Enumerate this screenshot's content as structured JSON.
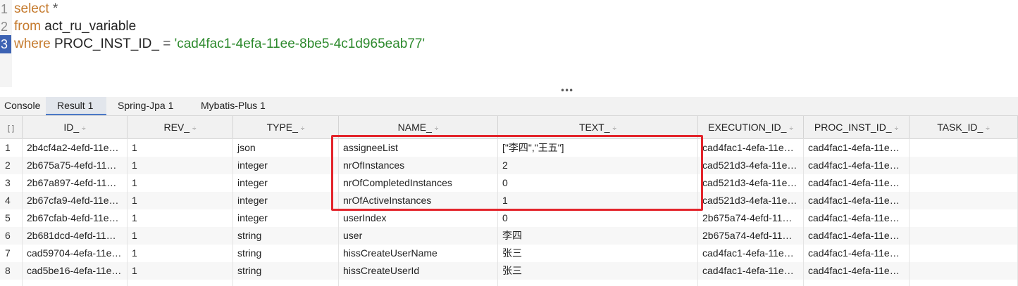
{
  "editor": {
    "lines": [
      {
        "num": "1",
        "parts": [
          {
            "t": "select",
            "k": "kw"
          },
          {
            "t": " *",
            "k": "sym"
          }
        ]
      },
      {
        "num": "2",
        "parts": [
          {
            "t": "from",
            "k": "kw"
          },
          {
            "t": " act_ru_variable",
            "k": ""
          }
        ]
      },
      {
        "num": "3",
        "parts": [
          {
            "t": "where",
            "k": "kw"
          },
          {
            "t": " PROC_INST_ID_ ",
            "k": ""
          },
          {
            "t": "=",
            "k": "sym"
          },
          {
            "t": " 'cad4fac1-4efa-11ee-8be5-4c1d965eab77'",
            "k": "str"
          }
        ]
      }
    ],
    "active_line": "3"
  },
  "splitter_glyph": "•••",
  "tabs": [
    {
      "label": "Console",
      "active": false
    },
    {
      "label": "Result 1",
      "active": true
    },
    {
      "label": "Spring-Jpa 1",
      "active": false
    },
    {
      "label": "Mybatis-Plus 1",
      "active": false
    }
  ],
  "grid": {
    "corner_glyph": "[ ]",
    "sort_glyph": "÷",
    "columns": [
      "ID_",
      "REV_",
      "TYPE_",
      "NAME_",
      "TEXT_",
      "EXECUTION_ID_",
      "PROC_INST_ID_",
      "TASK_ID_"
    ],
    "rows": [
      [
        "1",
        "2b4cf4a2-4efd-11e…",
        "1",
        "json",
        "assigneeList",
        "[\"李四\",\"王五\"]",
        "cad4fac1-4efa-11e…",
        "cad4fac1-4efa-11e…",
        ""
      ],
      [
        "2",
        "2b675a75-4efd-11…",
        "1",
        "integer",
        "nrOfInstances",
        "2",
        "cad521d3-4efa-11e…",
        "cad4fac1-4efa-11e…",
        ""
      ],
      [
        "3",
        "2b67a897-4efd-11…",
        "1",
        "integer",
        "nrOfCompletedInstances",
        "0",
        "cad521d3-4efa-11e…",
        "cad4fac1-4efa-11e…",
        ""
      ],
      [
        "4",
        "2b67cfa9-4efd-11e…",
        "1",
        "integer",
        "nrOfActiveInstances",
        "1",
        "cad521d3-4efa-11e…",
        "cad4fac1-4efa-11e…",
        ""
      ],
      [
        "5",
        "2b67cfab-4efd-11e…",
        "1",
        "integer",
        "userIndex",
        "0",
        "2b675a74-4efd-11…",
        "cad4fac1-4efa-11e…",
        ""
      ],
      [
        "6",
        "2b681dcd-4efd-11…",
        "1",
        "string",
        "user",
        "李四",
        "2b675a74-4efd-11…",
        "cad4fac1-4efa-11e…",
        ""
      ],
      [
        "7",
        "cad59704-4efa-11e…",
        "1",
        "string",
        "hissCreateUserName",
        "张三",
        "cad4fac1-4efa-11e…",
        "cad4fac1-4efa-11e…",
        ""
      ],
      [
        "8",
        "cad5be16-4efa-11e…",
        "1",
        "string",
        "hissCreateUserId",
        "张三",
        "cad4fac1-4efa-11e…",
        "cad4fac1-4efa-11e…",
        ""
      ]
    ]
  },
  "colors": {
    "keyword": "#c57a2d",
    "string": "#2d8a2d",
    "highlight_box": "#e3242b",
    "active_tab_underline": "#4a78c6"
  }
}
